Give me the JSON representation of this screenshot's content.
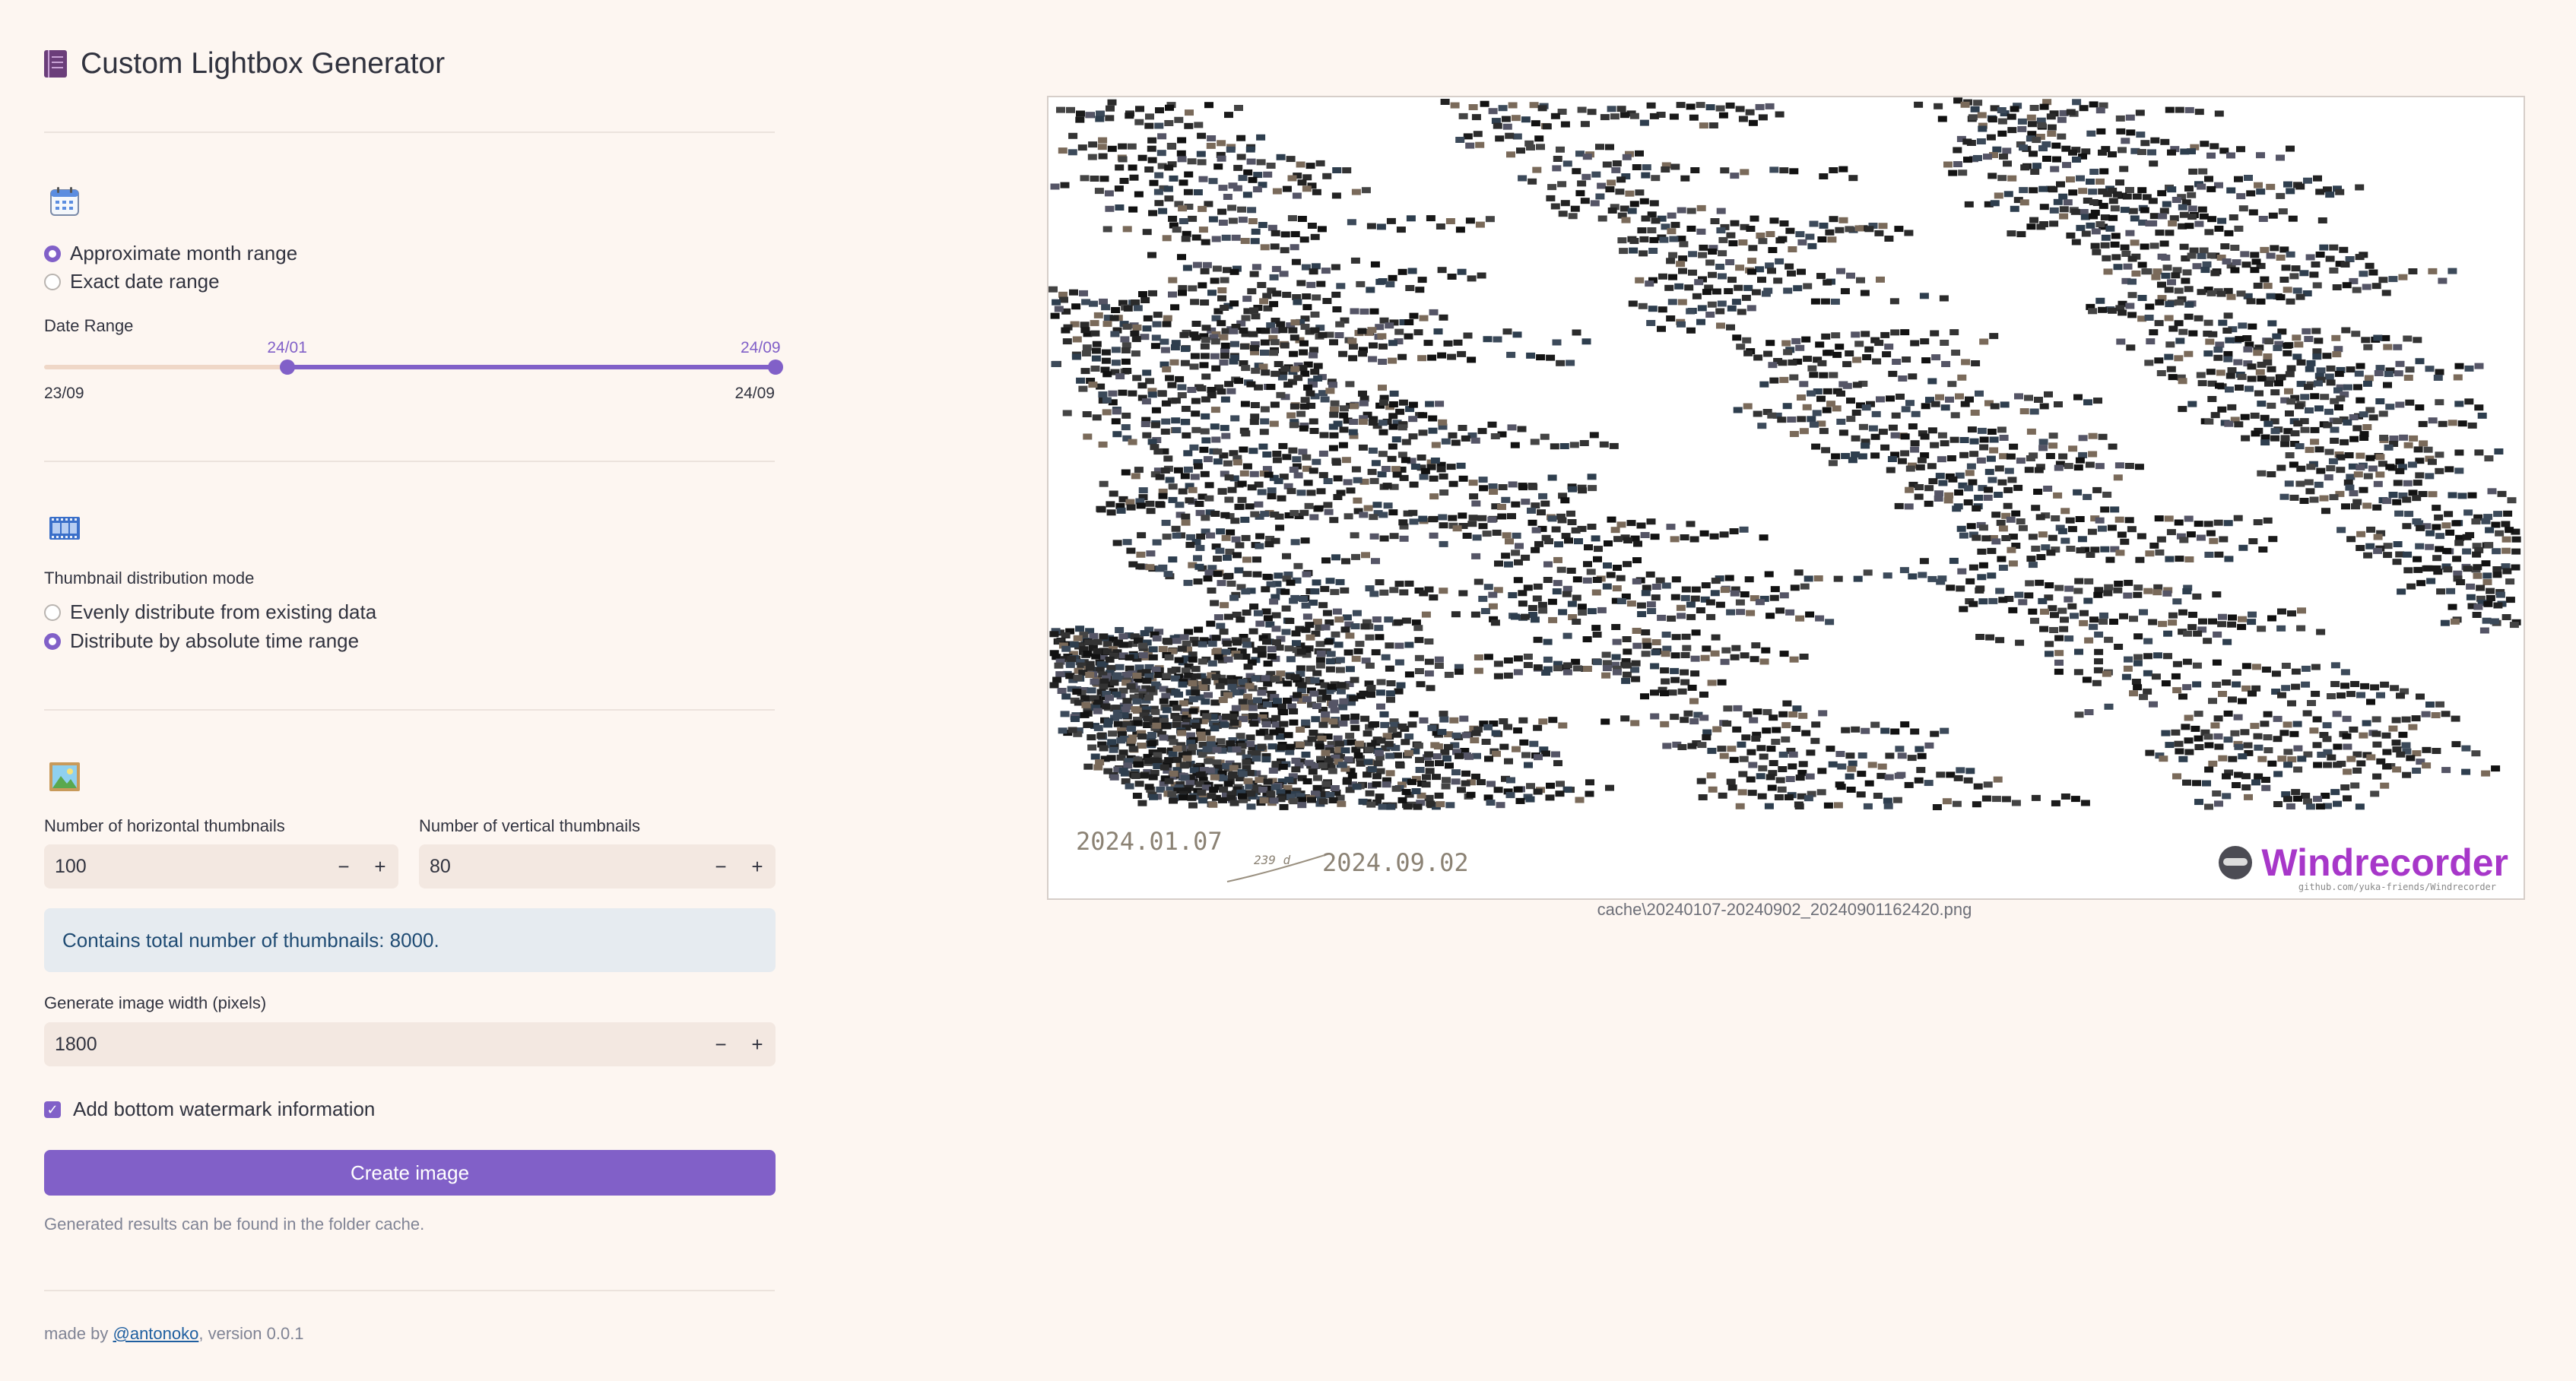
{
  "app": {
    "title": "Custom Lightbox Generator",
    "title_icon": "book-icon"
  },
  "date_section": {
    "icon": "calendar-icon",
    "options": [
      {
        "label": "Approximate month range",
        "selected": true
      },
      {
        "label": "Exact date range",
        "selected": false
      }
    ],
    "range_label": "Date Range",
    "range_start_value": "24/01",
    "range_end_value": "24/09",
    "range_min_label": "23/09",
    "range_max_label": "24/09",
    "range_start_fraction": 0.333,
    "range_end_fraction": 1.0
  },
  "thumbnail_section": {
    "icon": "film-frames-icon",
    "mode_label": "Thumbnail distribution mode",
    "options": [
      {
        "label": "Evenly distribute from existing data",
        "selected": false
      },
      {
        "label": "Distribute by absolute time range",
        "selected": true
      }
    ]
  },
  "image_section": {
    "icon": "picture-icon",
    "horizontal_label": "Number of horizontal thumbnails",
    "horizontal_value": "100",
    "vertical_label": "Number of vertical thumbnails",
    "vertical_value": "80",
    "info_text": "Contains total number of thumbnails: 8000.",
    "width_label": "Generate image width (pixels)",
    "width_value": "1800",
    "minus": "−",
    "plus": "+",
    "watermark_label": "Add bottom watermark information",
    "watermark_checked": true,
    "create_button": "Create image",
    "hint": "Generated results can be found in the folder cache."
  },
  "footer": {
    "prefix": "made by ",
    "author": "@antonoko",
    "suffix": ", version 0.0.1"
  },
  "preview": {
    "start_date": "2024.01.07",
    "days": "239 d",
    "end_date": "2024.09.02",
    "brand": "Windrecorder",
    "brand_url": "github.com/yuka-friends/Windrecorder",
    "caption": "cache\\20240107-20240902_20240901162420.png"
  },
  "colors": {
    "accent": "#8160c8",
    "background": "#fdf6f1",
    "info_bg": "#e6ebf0",
    "input_bg": "#f3e8e1"
  }
}
